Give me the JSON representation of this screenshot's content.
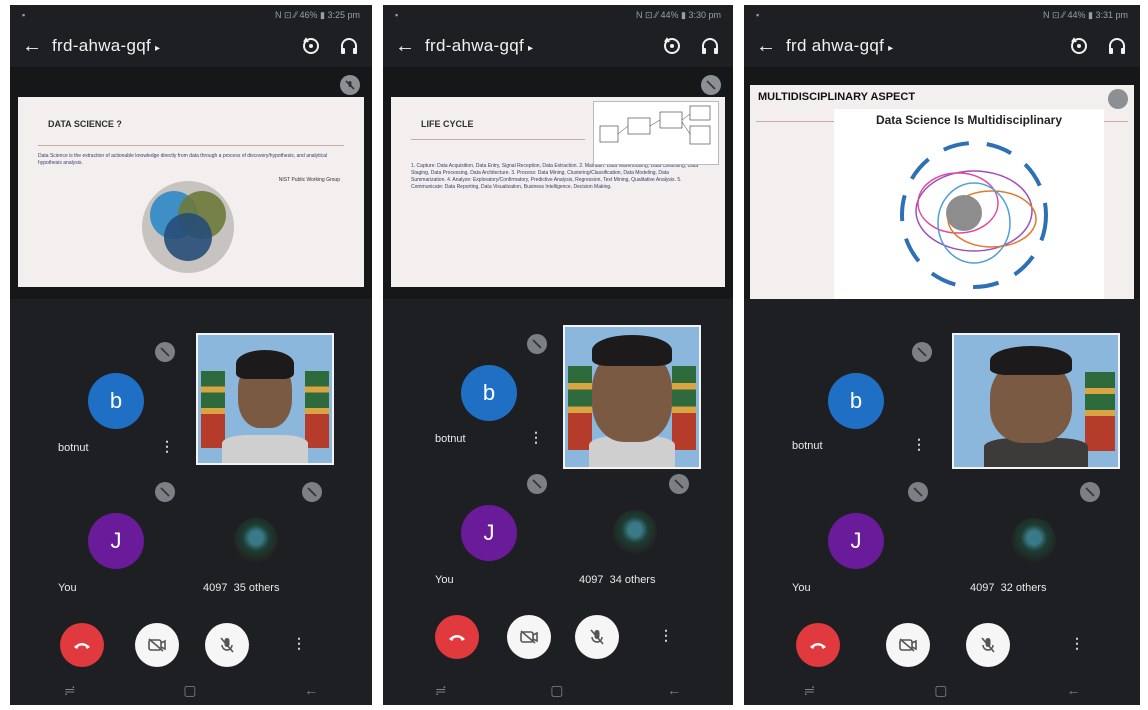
{
  "screens": [
    {
      "status": {
        "left": "▪",
        "right": "N ⊡ ⁄⁄ 46% ▮ 3:25 pm"
      },
      "meeting_code": "frd-ahwa-gqf",
      "slide": {
        "title": "DATA SCIENCE ?",
        "body": "Data Science is the extraction of actionable knowledge directly from data through a process of discovery/hypothesis, and analytical hypothesis analysis.",
        "credit": "NIST Public Working Group"
      },
      "participant_b": {
        "initial": "b",
        "name": "botnut"
      },
      "participant_you": {
        "initial": "J",
        "name": "You"
      },
      "others_count": "4097",
      "others_label": "35 others"
    },
    {
      "status": {
        "left": "▪",
        "right": "N ⊡ ⁄⁄ 44% ▮ 3:30 pm"
      },
      "meeting_code": "frd-ahwa-gqf",
      "slide": {
        "title": "LIFE CYCLE",
        "body": "1. Capture: Data Acquisition, Data Entry, Signal Reception, Data Extraction. 2. Maintain: Data Warehousing, Data Cleansing, Data Staging, Data Processing, Data Architecture. 3. Process: Data Mining, Clustering/Classification, Data Modeling, Data Summarization. 4. Analyze: Exploratory/Confirmatory, Predictive Analysis, Regression, Text Mining, Qualitative Analysis. 5. Communicate: Data Reporting, Data Visualization, Business Intelligence, Decision Making.",
        "credit": ""
      },
      "participant_b": {
        "initial": "b",
        "name": "botnut"
      },
      "participant_you": {
        "initial": "J",
        "name": "You"
      },
      "others_count": "4097",
      "others_label": "34 others"
    },
    {
      "status": {
        "left": "▪",
        "right": "N ⊡ ⁄⁄ 44% ▮ 3:31 pm"
      },
      "meeting_code": "frd ahwa-gqf",
      "slide": {
        "title": "MULTIDISCIPLINARY ASPECT",
        "subtitle": "Data Science Is Multidisciplinary",
        "body": "",
        "credit": ""
      },
      "participant_b": {
        "initial": "b",
        "name": "botnut"
      },
      "participant_you": {
        "initial": "J",
        "name": "You"
      },
      "others_count": "4097",
      "others_label": "32 others"
    }
  ],
  "colors": {
    "end_call": "#e0393e",
    "avatar_b": "#1f6fc5",
    "avatar_j": "#6a1b9a",
    "background": "#1d1f22"
  },
  "icons": {
    "back": "arrow-left",
    "switch_camera": "camera-switch",
    "audio_output": "headphones",
    "mute": "mic-off",
    "end_call": "phone-hangup",
    "camera_off": "video-off",
    "more": "more-vert"
  }
}
